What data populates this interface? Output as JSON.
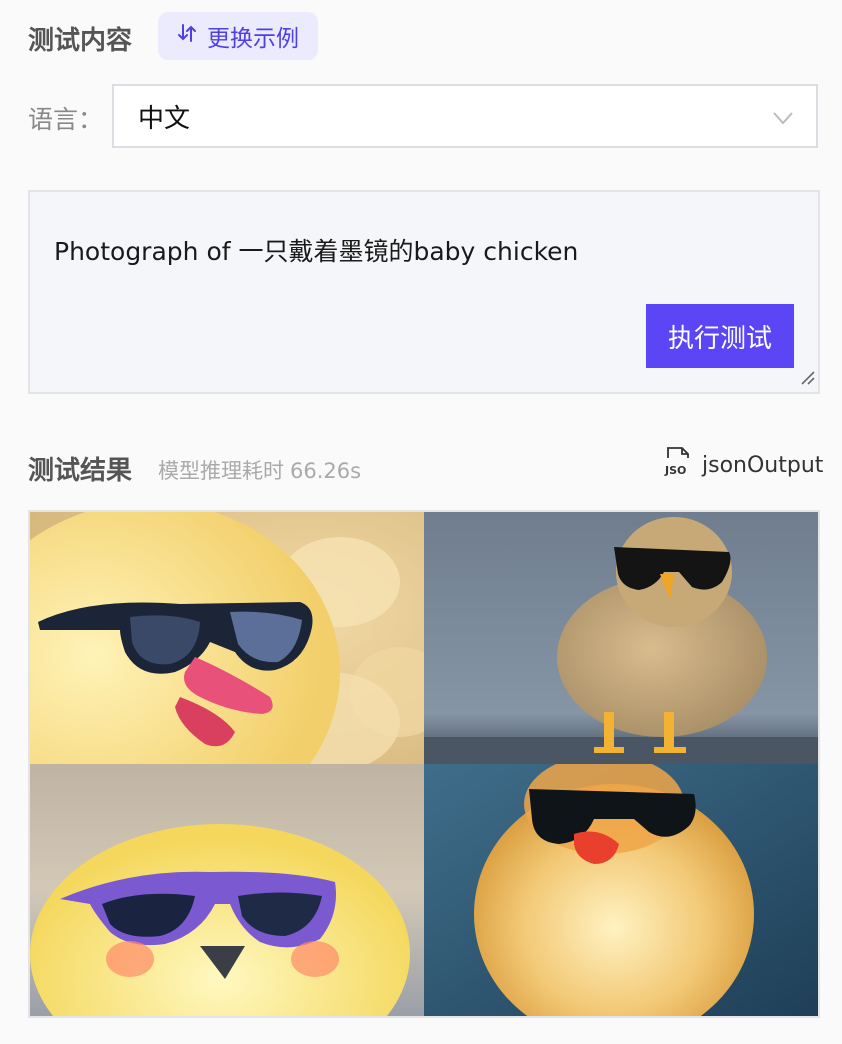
{
  "header": {
    "title": "测试内容",
    "swap_label": "更换示例"
  },
  "language": {
    "label": "语言：",
    "value": "中文"
  },
  "prompt": {
    "text": "Photograph of 一只戴着墨镜的baby chicken",
    "run_label": "执行测试"
  },
  "results": {
    "title": "测试结果",
    "latency_label": "模型推理耗时",
    "latency_value": "66.26s",
    "json_label": "jsonOutput",
    "images": [
      {
        "name": "chick-image-1",
        "description_icon": "chick-with-black-sunglasses-icon"
      },
      {
        "name": "chick-image-2",
        "description_icon": "fluffy-chick-standing-icon"
      },
      {
        "name": "chick-image-3",
        "description_icon": "chick-with-purple-sunglasses-icon"
      },
      {
        "name": "chick-image-4",
        "description_icon": "chick-with-sunglasses-blue-bg-icon"
      }
    ]
  },
  "colors": {
    "accent": "#5b45f5",
    "accent_light": "#ecebfd"
  }
}
